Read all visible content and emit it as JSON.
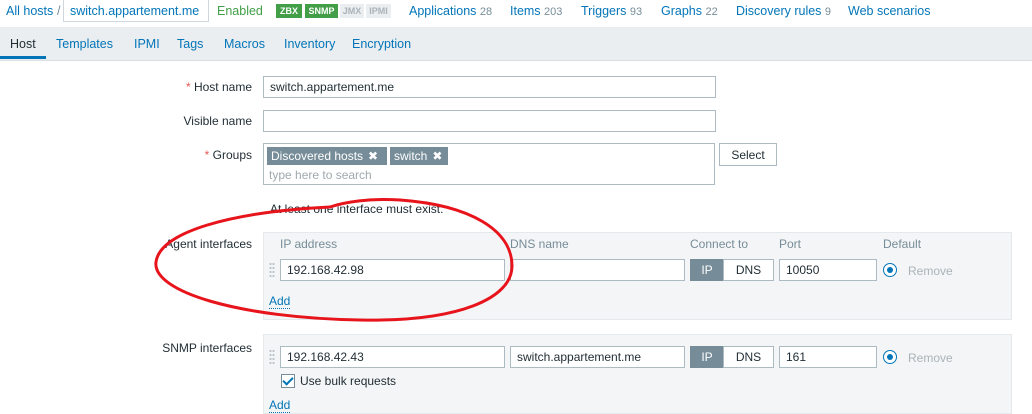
{
  "header": {
    "all_hosts": "All hosts",
    "separator": "/",
    "host": "switch.appartement.me",
    "status": "Enabled",
    "badges": [
      "ZBX",
      "SNMP",
      "JMX",
      "IPMI"
    ],
    "links": [
      {
        "label": "Applications",
        "count": "28"
      },
      {
        "label": "Items",
        "count": "203"
      },
      {
        "label": "Triggers",
        "count": "93"
      },
      {
        "label": "Graphs",
        "count": "22"
      },
      {
        "label": "Discovery rules",
        "count": "9"
      },
      {
        "label": "Web scenarios",
        "count": ""
      }
    ]
  },
  "tabs": [
    "Host",
    "Templates",
    "IPMI",
    "Tags",
    "Macros",
    "Inventory",
    "Encryption"
  ],
  "form": {
    "host_name_label": "Host name",
    "host_name_value": "switch.appartement.me",
    "visible_name_label": "Visible name",
    "visible_name_value": "",
    "groups_label": "Groups",
    "groups": [
      "Discovered hosts",
      "switch"
    ],
    "groups_placeholder": "type here to search",
    "select_button": "Select",
    "required_mark": "*",
    "interface_warning": "At least one interface must exist."
  },
  "agent_interfaces": {
    "label": "Agent interfaces",
    "columns": [
      "IP address",
      "DNS name",
      "Connect to",
      "Port",
      "Default"
    ],
    "rows": [
      {
        "ip": "192.168.42.98",
        "dns": "",
        "connect_ip": "IP",
        "connect_dns": "DNS",
        "port": "10050",
        "remove": "Remove"
      }
    ],
    "add": "Add"
  },
  "snmp_interfaces": {
    "label": "SNMP interfaces",
    "rows": [
      {
        "ip": "192.168.42.43",
        "dns": "switch.appartement.me",
        "connect_ip": "IP",
        "connect_dns": "DNS",
        "port": "161",
        "remove": "Remove"
      }
    ],
    "bulk_label": "Use bulk requests",
    "add": "Add"
  },
  "colors": {
    "link": "#0275b8",
    "enabled": "#429e47",
    "annotation": "#e8141b"
  }
}
